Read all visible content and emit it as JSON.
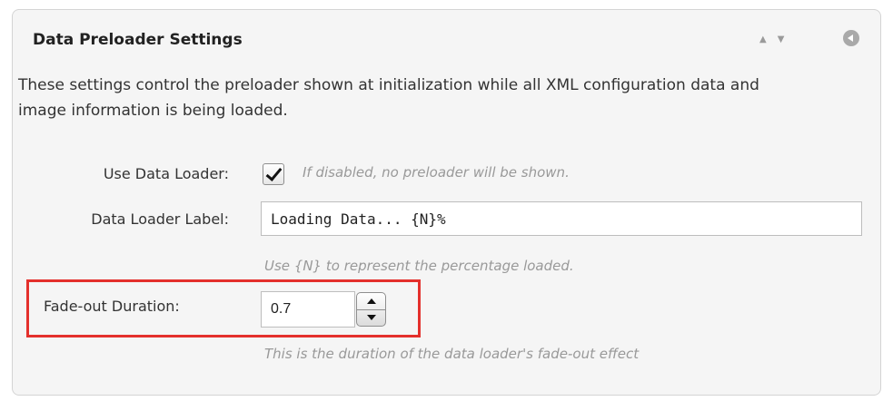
{
  "panel": {
    "title": "Data Preloader Settings",
    "description": "These settings control the preloader shown at initialization while all XML configuration data and image information is being loaded."
  },
  "fields": {
    "use_data_loader": {
      "label": "Use Data Loader:",
      "checked": true,
      "hint": "If disabled, no preloader will be shown."
    },
    "data_loader_label": {
      "label": "Data Loader Label:",
      "value": "Loading Data... {N}%",
      "hint": "Use {N} to represent the percentage loaded."
    },
    "fade_out_duration": {
      "label": "Fade-out Duration:",
      "value": "0.7",
      "hint": "This is the duration of the data loader's fade-out effect"
    }
  },
  "icons": {
    "move_up": "triangle-up-icon",
    "move_down": "triangle-down-icon",
    "collapse": "circle-arrow-left-icon"
  },
  "colors": {
    "panel_bg": "#f5f5f5",
    "highlight": "#e4302c",
    "hint_text": "#999999"
  }
}
